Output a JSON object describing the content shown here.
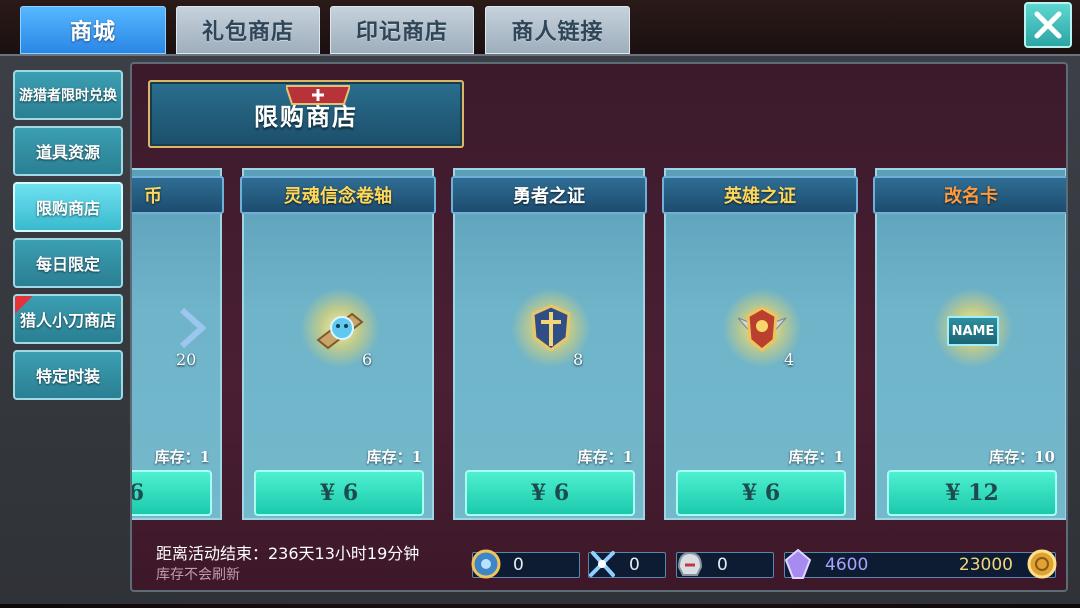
{
  "tabs": [
    {
      "label": "商城",
      "active": true
    },
    {
      "label": "礼包商店",
      "active": false
    },
    {
      "label": "印记商店",
      "active": false
    },
    {
      "label": "商人链接",
      "active": false
    }
  ],
  "sidebar": {
    "items": [
      {
        "label": "游猎者限时兑换"
      },
      {
        "label": "道具资源"
      },
      {
        "label": "限购商店",
        "active": true
      },
      {
        "label": "每日限定"
      },
      {
        "label": "猎人小刀商店",
        "flag": "red"
      },
      {
        "label": "特定时装"
      }
    ]
  },
  "header": {
    "title": "限购商店"
  },
  "cards": [
    {
      "title": "币",
      "count": "20",
      "stock": "库存：1",
      "price": "6"
    },
    {
      "title": "灵魂信念卷轴",
      "count": "6",
      "stock": "库存：1",
      "price": "¥ 6",
      "title_color": "#ffd85a"
    },
    {
      "title": "勇者之证",
      "count": "8",
      "stock": "库存：1",
      "price": "¥ 6",
      "title_color": "#ffffff"
    },
    {
      "title": "英雄之证",
      "count": "4",
      "stock": "库存：1",
      "price": "¥ 6",
      "title_color": "#ffd85a"
    },
    {
      "title": "改名卡",
      "count": "",
      "stock": "库存：10",
      "price": "¥ 12",
      "title_color": "#ff9a3d",
      "icon_text": "NAME"
    }
  ],
  "footer": {
    "countdown": "距离活动结束：236天13小时19分钟",
    "refresh_note": "库存不会刷新"
  },
  "currencies": [
    {
      "icon": "gear-coin-icon",
      "value": "0"
    },
    {
      "icon": "crossed-swords-icon",
      "value": "0"
    },
    {
      "icon": "helmet-icon",
      "value": "0"
    },
    {
      "icon": "purple-crystal-icon",
      "value": "4600",
      "value2": "23000",
      "icon2": "gold-coin-icon"
    }
  ],
  "colors": {
    "active_tab": "#3a9bf0",
    "inactive_tab": "#b2c0cc",
    "buy_button": "#2fdcbf",
    "content_bg": "#441c30",
    "header_border": "#d9b764"
  }
}
